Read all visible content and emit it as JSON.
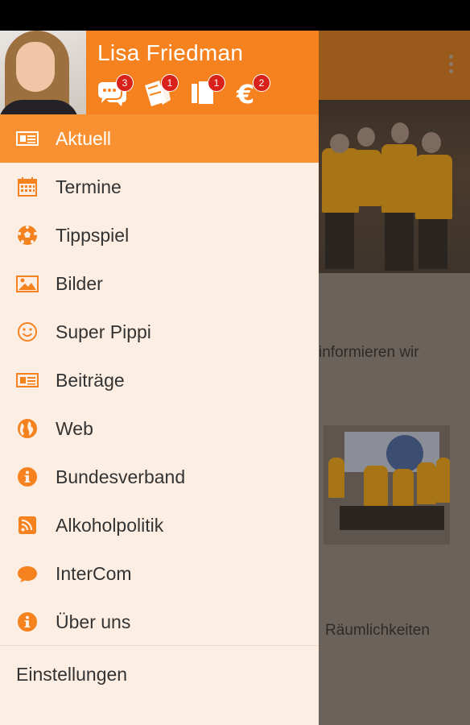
{
  "user": {
    "name": "Lisa Friedman"
  },
  "header_icons": [
    {
      "icon": "chat-bubbles-icon",
      "badge": "3"
    },
    {
      "icon": "tickets-icon",
      "badge": "1"
    },
    {
      "icon": "documents-icon",
      "badge": "1"
    },
    {
      "icon": "euro-icon",
      "badge": "2"
    }
  ],
  "nav": {
    "items": [
      {
        "label": "Aktuell",
        "icon": "newspaper-icon",
        "active": true
      },
      {
        "label": "Termine",
        "icon": "calendar-icon"
      },
      {
        "label": "Tippspiel",
        "icon": "soccer-ball-icon"
      },
      {
        "label": "Bilder",
        "icon": "image-icon"
      },
      {
        "label": "Super Pippi",
        "icon": "smiley-icon"
      },
      {
        "label": "Beiträge",
        "icon": "newspaper-icon"
      },
      {
        "label": "Web",
        "icon": "globe-icon"
      },
      {
        "label": "Bundesverband",
        "icon": "info-icon"
      },
      {
        "label": "Alkoholpolitik",
        "icon": "rss-icon"
      },
      {
        "label": "InterCom",
        "icon": "chat-bubble-icon"
      },
      {
        "label": "Über uns",
        "icon": "info-icon"
      }
    ],
    "settings_label": "Einstellungen"
  },
  "background": {
    "text1": "informieren wir",
    "text2": "Räumlichkeiten"
  },
  "colors": {
    "accent": "#f5821f",
    "active_item": "#f99132",
    "drawer_bg": "#fdeee3",
    "badge": "#d8211a"
  }
}
